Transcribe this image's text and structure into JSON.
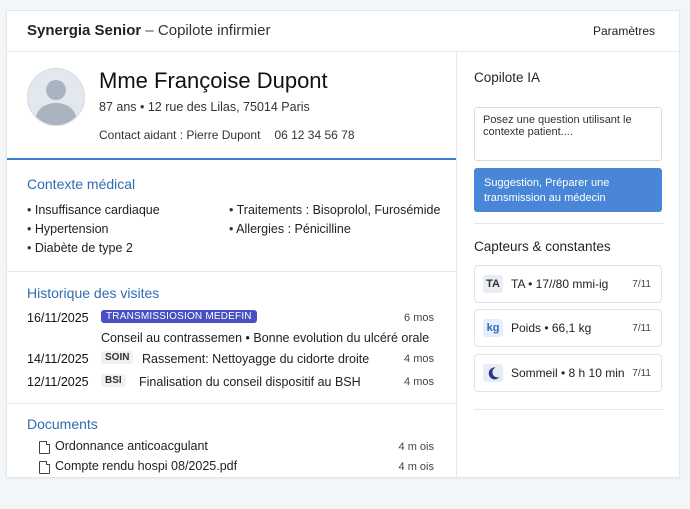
{
  "header": {
    "brand": "Synergia Senior",
    "separator": " – ",
    "subtitle": "Copilote infirmier",
    "settings_label": "Paramètres"
  },
  "patient": {
    "name": "Mme Françoise Dupont",
    "info": "87 ans • 12 rue des Lilas, 75014 Paris",
    "contact": "Contact aidant : Pierre Dupont",
    "phone": "06 12 34 56 78"
  },
  "context": {
    "title": "Contexte médical",
    "left_items": [
      "Insuffisance cardiaque",
      "Hypertension",
      "Diabète de type 2"
    ],
    "right_items": [
      "Traitements : Bisoprolol, Furosémide",
      "Allergies : Pénicilline"
    ]
  },
  "history": {
    "title": "Historique des visites",
    "visits": [
      {
        "date": "16/11/2025",
        "tag": "TRANSMISSIOSION MEDEFIN",
        "text": "Conseil au contrassemen • Bonne evolution du ulcéré orale",
        "when": "6 mos"
      },
      {
        "date": "14/11/2025",
        "tag": "SOIN",
        "text": "Rassement: Nettoyagge du cidorte droite",
        "when": "4 mos"
      },
      {
        "date": "12/11/2025",
        "tag": "BSI",
        "text": "Finalisation du conseil dispositif au BSH",
        "when": "4 mos"
      }
    ]
  },
  "documents": {
    "title": "Documents",
    "items": [
      {
        "name": "Ordonnance anticoacgulant",
        "when": "4 m ois"
      },
      {
        "name": "Compte rendu hospi 08/2025.pdf",
        "when": "4 m ois"
      }
    ]
  },
  "copilot": {
    "title": "Copilote IA",
    "placeholder": "Posez une question utilisant le contexte patient....",
    "suggestion": "Suggestion, Préparer une transmission au médecin"
  },
  "sensors": {
    "title": "Capteurs & constantes",
    "items": [
      {
        "icon_text": "TA",
        "icon": "blood-pressure-icon",
        "label": "TA • 17//80 mmi-ig",
        "date": "7/11"
      },
      {
        "icon_text": "kg",
        "icon": "weight-icon",
        "label": "Poids • 66,1 kg",
        "date": "7/11"
      },
      {
        "icon_text": "",
        "icon": "moon-icon",
        "label": "Sommeil • 8 h 10 min",
        "date": "7/11"
      }
    ]
  },
  "colors": {
    "accent": "#3b7fd0",
    "section_title": "#2f6db3",
    "tag_primary": "#4b4fc4",
    "button": "#4a86d8"
  }
}
